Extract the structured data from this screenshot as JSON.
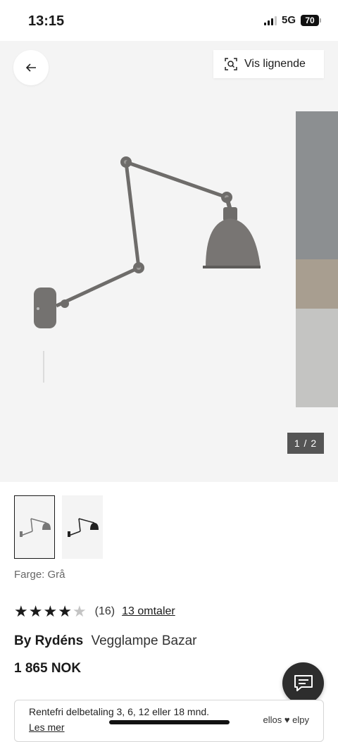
{
  "status": {
    "time": "13:15",
    "network": "5G",
    "battery": "70"
  },
  "gallery": {
    "similar_label": "Vis lignende",
    "counter": "1 / 2"
  },
  "product": {
    "color_label": "Farge: Grå",
    "rating_value": 4,
    "rating_max": 5,
    "reviews_count": "(16)",
    "reviews_link": "13 omtaler",
    "brand": "By Rydéns",
    "name": "Vegglampe Bazar",
    "price": "1 865 NOK"
  },
  "finance": {
    "text": "Rentefri delbetaling 3, 6, 12 eller 18 mnd.",
    "link": "Les mer",
    "logos": "ellos ♥ elpy"
  },
  "icons": {
    "back": "arrow-left-icon",
    "similar": "visual-search-icon",
    "chat": "chat-icon"
  },
  "colors": {
    "lamp": "#6e6c6a",
    "accent": "#1a1a1a"
  }
}
